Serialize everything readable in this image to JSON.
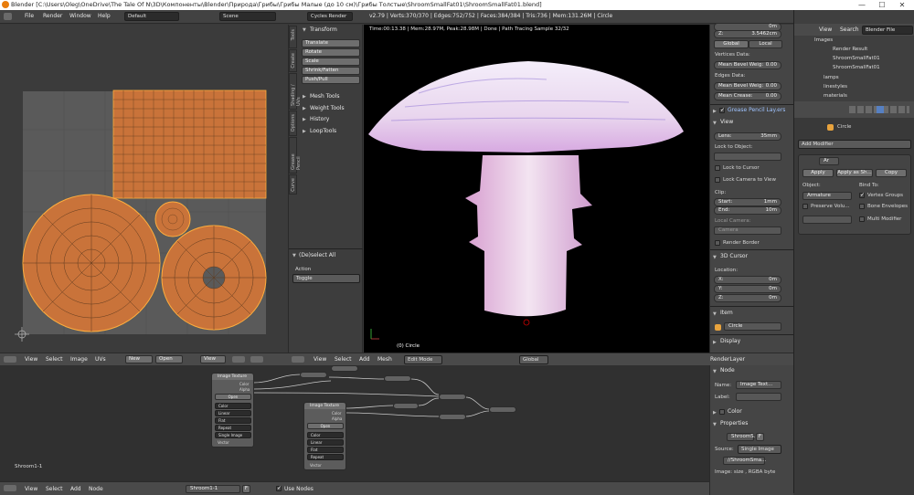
{
  "window": {
    "title": "Blender [C:\\Users\\Oleg\\OneDrive\\The Tale Of N\\3D\\Компоненты\\Blender\\Природа\\Грибы\\Грибы Малые (до 10 см)\\Грибы Толстые\\ShroomSmallFat01\\ShroomSmallFat01.blend]",
    "min": "—",
    "max": "☐",
    "close": "✕"
  },
  "menu": {
    "file": "File",
    "render": "Render",
    "window": "Window",
    "help": "Help",
    "layout": "Default",
    "scene": "Scene",
    "engine": "Cycles Render",
    "stats": "v2.79 | Verts:370/370 | Edges:752/752 | Faces:384/384 | Tris:736 | Mem:131.26M | Circle"
  },
  "uv_editor": {
    "header": {
      "view": "View",
      "select": "Select",
      "image": "Image",
      "uvs": "UVs",
      "new": "New",
      "open": "Open",
      "view2": "View"
    }
  },
  "toolshelf": {
    "tabs": [
      "Tools",
      "Create",
      "Shading / UVs",
      "Options",
      "Grease Pencil",
      "Curve"
    ],
    "transform": "Transform",
    "translate": "Translate",
    "rotate": "Rotate",
    "scale": "Scale",
    "shrink": "Shrink/Fatten",
    "push": "Push/Pull",
    "mesh_tools": "Mesh Tools",
    "weight_tools": "Weight Tools",
    "history": "History",
    "loop_tools": "LoopTools",
    "op_title": "(De)select All",
    "action_label": "Action",
    "action_value": "Toggle"
  },
  "viewport": {
    "status": "Time:00:13.38 | Mem:28.97M, Peak:28.98M | Done | Path Tracing Sample 32/32",
    "object": "(0) Circle",
    "header": {
      "view": "View",
      "select": "Select",
      "add": "Add",
      "mesh": "Mesh",
      "mode": "Edit Mode",
      "orientation": "Global",
      "layer": "RenderLayer"
    }
  },
  "npanel": {
    "z_label": "Z:",
    "z_value": "3.5462cm",
    "top_value": "0m",
    "global": "Global",
    "local": "Local",
    "vertices_data": "Vertices Data:",
    "mean_bevel_weight": "Mean Bevel Weig:",
    "mbw_value": "0.00",
    "edges_data": "Edges Data:",
    "mean_bevel_weight2": "Mean Bevel Weig:",
    "mbw2_value": "0.00",
    "mean_crease": "Mean Crease:",
    "mc_value": "0.00",
    "grease_pencil": "Grease Pencil Lay.ers",
    "view_section": "View",
    "lens": "Lens:",
    "lens_value": "35mm",
    "lock_to_object": "Lock to Object:",
    "lock_to_cursor": "Lock to Cursor",
    "lock_camera": "Lock Camera to View",
    "clip": "Clip:",
    "start": "Start:",
    "start_value": "1mm",
    "end": "End:",
    "end_value": "10m",
    "local_camera": "Local Camera:",
    "camera": "Camera",
    "render_border": "Render Border",
    "cursor3d": "3D Cursor",
    "location": "Location:",
    "x": "X:",
    "x_value": "0m",
    "y": "Y:",
    "y_value": "0m",
    "zc": "Z:",
    "zc_value": "0m",
    "item": "Item",
    "circle": "Circle",
    "display": "Display"
  },
  "outliner": {
    "view": "View",
    "search": "Search",
    "blender_file": "Blender File",
    "items": [
      "Images",
      "Render Result",
      "ShroomSmallFat01",
      "ShroomSmallFat01",
      "lamps",
      "linestyles",
      "materials"
    ]
  },
  "properties": {
    "object_name": "Circle",
    "add_modifier": "Add Modifier",
    "mod_name": "Ar",
    "apply": "Apply",
    "apply_as": "Apply as Sh...",
    "copy": "Copy",
    "object_label": "Object:",
    "bind_to": "Bind To:",
    "armature": "Armature",
    "vertex_groups": "Vertex Groups",
    "preserve_volume": "Preserve Volu...",
    "bone_envelopes": "Bone Envelopes",
    "multi_modifier": "Multi Modifier"
  },
  "node_editor": {
    "material": "Shroom1-1",
    "header": {
      "view": "View",
      "select": "Select",
      "add": "Add",
      "node": "Node",
      "material": "Shroom1-1",
      "use_nodes": "Use Nodes",
      "f": "F"
    },
    "node1": {
      "title": "Image Texture",
      "color_out": "Color",
      "alpha_out": "Alpha",
      "open": "Open",
      "color": "Color",
      "linear": "Linear",
      "flat": "Flat",
      "repeat": "Repeat",
      "single_image": "Single Image",
      "vector": "Vector"
    },
    "node2": {
      "title": "Image Texture",
      "color_out": "Color",
      "alpha_out": "Alpha",
      "open": "Open",
      "color": "Color",
      "linear": "Linear",
      "flat": "Flat",
      "repeat": "Repeat",
      "vector": "Vector"
    }
  },
  "node_panel": {
    "node": "Node",
    "name": "Name:",
    "name_value": "Image Text...",
    "label": "Label:",
    "color": "Color",
    "properties": "Properties",
    "image": "ShroomS...",
    "f": "F",
    "source": "Source:",
    "source_value": "Single Image",
    "path": "//ShroomSma...",
    "info": "Image: size , RGBA byte"
  }
}
